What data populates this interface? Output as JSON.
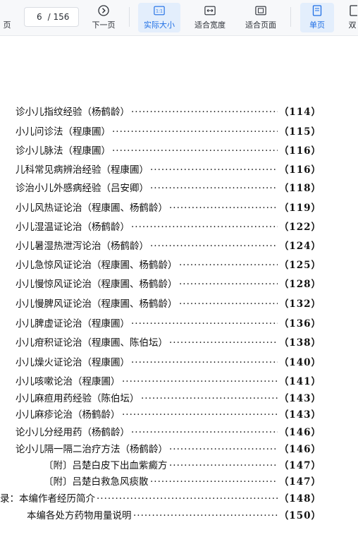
{
  "toolbar": {
    "prev_label": "页",
    "page_current": "6",
    "page_total": "/ 156",
    "next_label": "下一页",
    "actual_size_label": "实际大小",
    "actual_size_icon_text": "1:1",
    "fit_width_label": "适合宽度",
    "fit_page_label": "适合页面",
    "single_page_label": "单页",
    "double_page_label": "双"
  },
  "toc": [
    {
      "text": "诊小儿指纹经验（杨鹤龄）",
      "page": "（114）"
    },
    {
      "text": "小儿问诊法（程康圃）",
      "page": "（115）"
    },
    {
      "text": "诊小儿脉法（程康圃）",
      "page": "（116）"
    },
    {
      "text": "儿科常见病辨治经验（程康圃）",
      "page": "（116）"
    },
    {
      "text": "诊治小儿外感病经验（吕安卿）",
      "page": "（118）"
    },
    {
      "text": "小儿风热证论治（程康圃、杨鹤龄）",
      "page": "（119）"
    },
    {
      "text": "小儿湿温证论治（杨鹤龄）",
      "page": "（122）"
    },
    {
      "text": "小儿暑湿热泄泻论治（杨鹤龄）",
      "page": "（124）"
    },
    {
      "text": "小儿急惊风证论治（程康圃、杨鹤龄）",
      "page": "（125）"
    },
    {
      "text": "小儿慢惊风证论治（程康圃、杨鹤龄）",
      "page": "（128）"
    },
    {
      "text": "小儿慢脾风证论治（程康圃、杨鹤龄）",
      "page": "（132）"
    },
    {
      "text": "小儿脾虚证论治（程康圃）",
      "page": "（136）"
    },
    {
      "text": "小儿疳积证论治（程康圃、陈伯坛）",
      "page": "（138）"
    },
    {
      "text": "小儿燥火证论治（程康圃）",
      "page": "（140）"
    },
    {
      "text": "小儿咳嗽论治（程康圃）",
      "page": "（141）"
    },
    {
      "text": "小儿麻疸用药经验（陈伯坛）",
      "page": "（143）"
    },
    {
      "text": "小儿麻疹论治（杨鹤龄）",
      "page": "（143）"
    },
    {
      "text": "论小儿分经用药（杨鹤龄）",
      "page": "（146）"
    },
    {
      "text": "论小儿隔一隔二治疗方法（杨鹤龄）",
      "page": "（146）"
    },
    {
      "text": "〔附〕吕楚白皮下出血紫癜方",
      "page": "（147）"
    },
    {
      "text": "〔附〕吕楚白救急风痰散",
      "page": "（147）"
    },
    {
      "text": "录：本编作者经历简介",
      "page": "（148）"
    },
    {
      "text": "本编各处方药物用量说明",
      "page": "（150）"
    }
  ]
}
